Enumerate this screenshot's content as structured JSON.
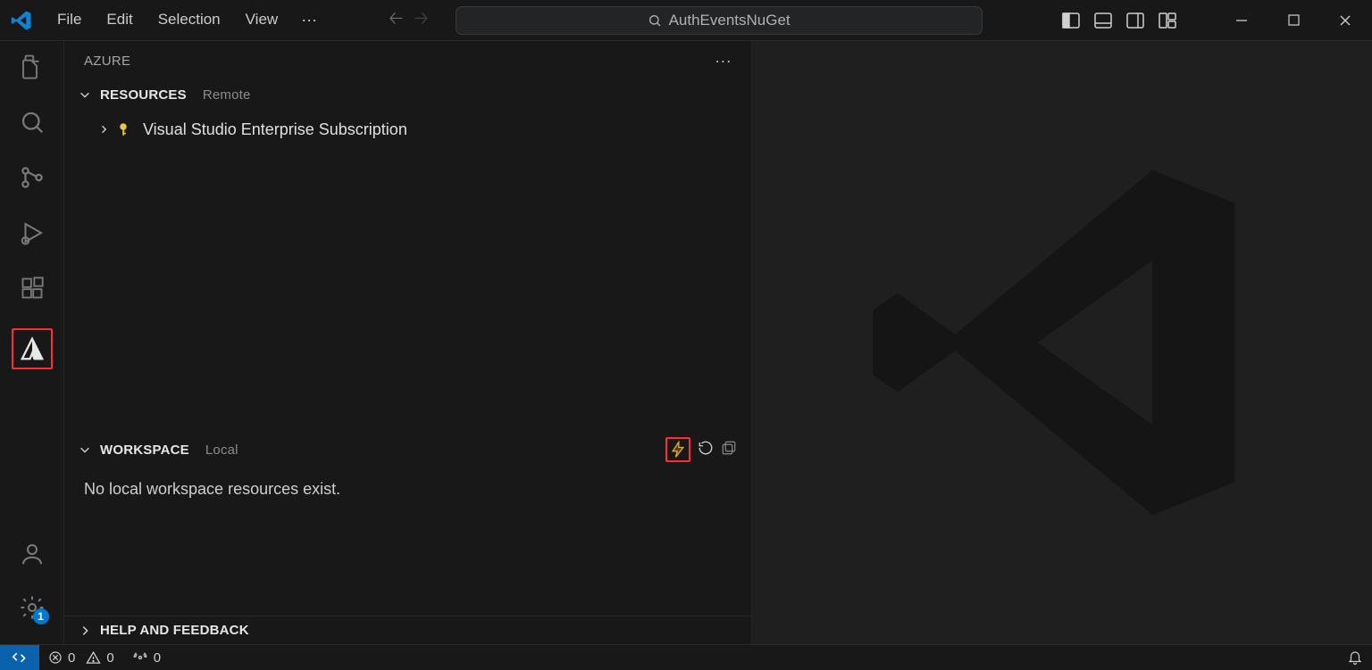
{
  "menu": {
    "file": "File",
    "edit": "Edit",
    "selection": "Selection",
    "view": "View",
    "more": "···"
  },
  "search": {
    "text": "AuthEventsNuGet"
  },
  "sidebar": {
    "title": "AZURE",
    "resources": {
      "label": "RESOURCES",
      "sub": "Remote",
      "item": "Visual Studio Enterprise Subscription"
    },
    "workspace": {
      "label": "WORKSPACE",
      "sub": "Local",
      "message": "No local workspace resources exist."
    },
    "help": {
      "label": "HELP AND FEEDBACK"
    }
  },
  "status": {
    "errors": "0",
    "warnings": "0",
    "ports": "0"
  },
  "badges": {
    "settings": "1"
  }
}
